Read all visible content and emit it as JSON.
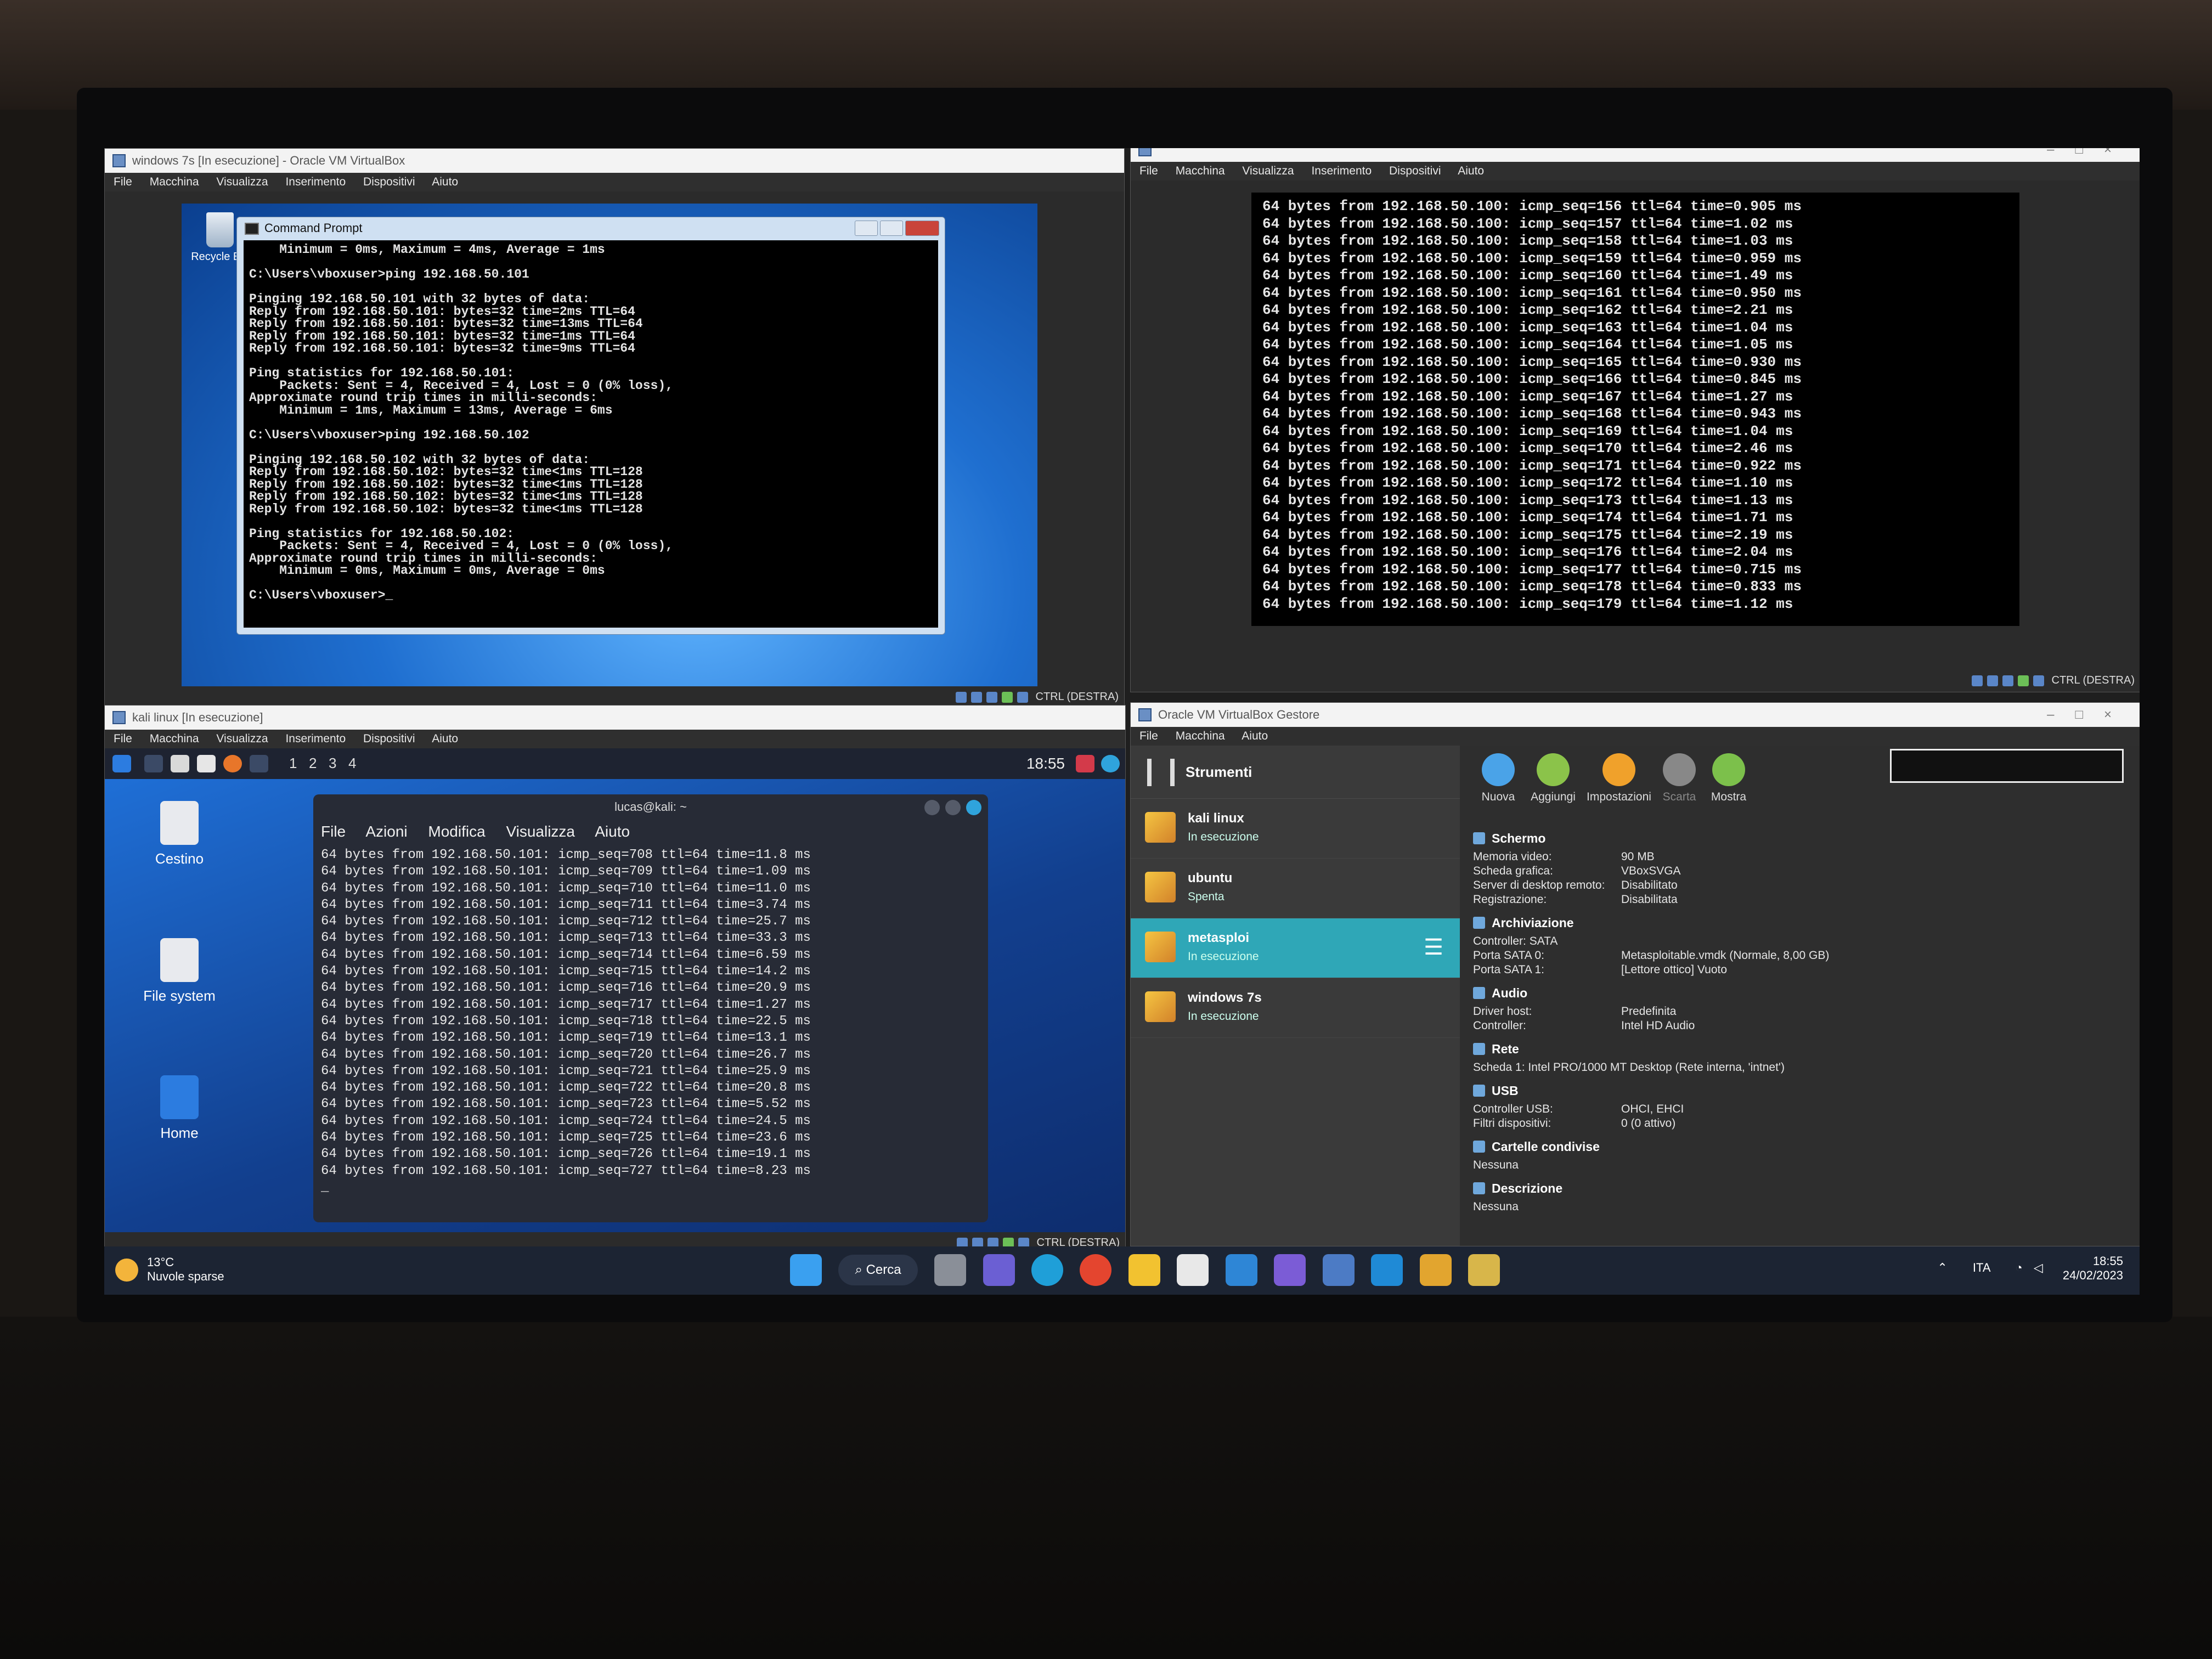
{
  "win7_vm": {
    "title": "windows 7s [In esecuzione] - Oracle VM VirtualBox",
    "menu": [
      "File",
      "Macchina",
      "Visualizza",
      "Inserimento",
      "Dispositivi",
      "Aiuto"
    ],
    "desktop_icon": "Recycle Bin",
    "cmd_title": "Command Prompt",
    "cmd_lines": [
      "    Minimum = 0ms, Maximum = 4ms, Average = 1ms",
      "",
      "C:\\Users\\vboxuser>ping 192.168.50.101",
      "",
      "Pinging 192.168.50.101 with 32 bytes of data:",
      "Reply from 192.168.50.101: bytes=32 time=2ms TTL=64",
      "Reply from 192.168.50.101: bytes=32 time=13ms TTL=64",
      "Reply from 192.168.50.101: bytes=32 time=1ms TTL=64",
      "Reply from 192.168.50.101: bytes=32 time=9ms TTL=64",
      "",
      "Ping statistics for 192.168.50.101:",
      "    Packets: Sent = 4, Received = 4, Lost = 0 (0% loss),",
      "Approximate round trip times in milli-seconds:",
      "    Minimum = 1ms, Maximum = 13ms, Average = 6ms",
      "",
      "C:\\Users\\vboxuser>ping 192.168.50.102",
      "",
      "Pinging 192.168.50.102 with 32 bytes of data:",
      "Reply from 192.168.50.102: bytes=32 time<1ms TTL=128",
      "Reply from 192.168.50.102: bytes=32 time<1ms TTL=128",
      "Reply from 192.168.50.102: bytes=32 time<1ms TTL=128",
      "Reply from 192.168.50.102: bytes=32 time<1ms TTL=128",
      "",
      "Ping statistics for 192.168.50.102:",
      "    Packets: Sent = 4, Received = 4, Lost = 0 (0% loss),",
      "Approximate round trip times in milli-seconds:",
      "    Minimum = 0ms, Maximum = 0ms, Average = 0ms",
      "",
      "C:\\Users\\vboxuser>_"
    ],
    "status_key": "CTRL (DESTRA)"
  },
  "meta_vm": {
    "menu": [
      "File",
      "Macchina",
      "Visualizza",
      "Inserimento",
      "Dispositivi",
      "Aiuto"
    ],
    "ping_lines": [
      "64 bytes from 192.168.50.100: icmp_seq=156 ttl=64 time=0.905 ms",
      "64 bytes from 192.168.50.100: icmp_seq=157 ttl=64 time=1.02 ms",
      "64 bytes from 192.168.50.100: icmp_seq=158 ttl=64 time=1.03 ms",
      "64 bytes from 192.168.50.100: icmp_seq=159 ttl=64 time=0.959 ms",
      "64 bytes from 192.168.50.100: icmp_seq=160 ttl=64 time=1.49 ms",
      "64 bytes from 192.168.50.100: icmp_seq=161 ttl=64 time=0.950 ms",
      "64 bytes from 192.168.50.100: icmp_seq=162 ttl=64 time=2.21 ms",
      "64 bytes from 192.168.50.100: icmp_seq=163 ttl=64 time=1.04 ms",
      "64 bytes from 192.168.50.100: icmp_seq=164 ttl=64 time=1.05 ms",
      "64 bytes from 192.168.50.100: icmp_seq=165 ttl=64 time=0.930 ms",
      "64 bytes from 192.168.50.100: icmp_seq=166 ttl=64 time=0.845 ms",
      "64 bytes from 192.168.50.100: icmp_seq=167 ttl=64 time=1.27 ms",
      "64 bytes from 192.168.50.100: icmp_seq=168 ttl=64 time=0.943 ms",
      "64 bytes from 192.168.50.100: icmp_seq=169 ttl=64 time=1.04 ms",
      "64 bytes from 192.168.50.100: icmp_seq=170 ttl=64 time=2.46 ms",
      "64 bytes from 192.168.50.100: icmp_seq=171 ttl=64 time=0.922 ms",
      "64 bytes from 192.168.50.100: icmp_seq=172 ttl=64 time=1.10 ms",
      "64 bytes from 192.168.50.100: icmp_seq=173 ttl=64 time=1.13 ms",
      "64 bytes from 192.168.50.100: icmp_seq=174 ttl=64 time=1.71 ms",
      "64 bytes from 192.168.50.100: icmp_seq=175 ttl=64 time=2.19 ms",
      "64 bytes from 192.168.50.100: icmp_seq=176 ttl=64 time=2.04 ms",
      "64 bytes from 192.168.50.100: icmp_seq=177 ttl=64 time=0.715 ms",
      "64 bytes from 192.168.50.100: icmp_seq=178 ttl=64 time=0.833 ms",
      "64 bytes from 192.168.50.100: icmp_seq=179 ttl=64 time=1.12 ms"
    ],
    "status_key": "CTRL (DESTRA)"
  },
  "kali_vm": {
    "title": "kali linux [In esecuzione]",
    "menu": [
      "File",
      "Macchina",
      "Visualizza",
      "Inserimento",
      "Dispositivi",
      "Aiuto"
    ],
    "workspaces": [
      "1",
      "2",
      "3",
      "4"
    ],
    "clock": "18:55",
    "desktop_icons": [
      "Cestino",
      "File system",
      "Home"
    ],
    "terminal_title": "lucas@kali: ~",
    "terminal_menu": [
      "File",
      "Azioni",
      "Modifica",
      "Visualizza",
      "Aiuto"
    ],
    "ping_lines": [
      "64 bytes from 192.168.50.101: icmp_seq=708 ttl=64 time=11.8 ms",
      "64 bytes from 192.168.50.101: icmp_seq=709 ttl=64 time=1.09 ms",
      "64 bytes from 192.168.50.101: icmp_seq=710 ttl=64 time=11.0 ms",
      "64 bytes from 192.168.50.101: icmp_seq=711 ttl=64 time=3.74 ms",
      "64 bytes from 192.168.50.101: icmp_seq=712 ttl=64 time=25.7 ms",
      "64 bytes from 192.168.50.101: icmp_seq=713 ttl=64 time=33.3 ms",
      "64 bytes from 192.168.50.101: icmp_seq=714 ttl=64 time=6.59 ms",
      "64 bytes from 192.168.50.101: icmp_seq=715 ttl=64 time=14.2 ms",
      "64 bytes from 192.168.50.101: icmp_seq=716 ttl=64 time=20.9 ms",
      "64 bytes from 192.168.50.101: icmp_seq=717 ttl=64 time=1.27 ms",
      "64 bytes from 192.168.50.101: icmp_seq=718 ttl=64 time=22.5 ms",
      "64 bytes from 192.168.50.101: icmp_seq=719 ttl=64 time=13.1 ms",
      "64 bytes from 192.168.50.101: icmp_seq=720 ttl=64 time=26.7 ms",
      "64 bytes from 192.168.50.101: icmp_seq=721 ttl=64 time=25.9 ms",
      "64 bytes from 192.168.50.101: icmp_seq=722 ttl=64 time=20.8 ms",
      "64 bytes from 192.168.50.101: icmp_seq=723 ttl=64 time=5.52 ms",
      "64 bytes from 192.168.50.101: icmp_seq=724 ttl=64 time=24.5 ms",
      "64 bytes from 192.168.50.101: icmp_seq=725 ttl=64 time=23.6 ms",
      "64 bytes from 192.168.50.101: icmp_seq=726 ttl=64 time=19.1 ms",
      "64 bytes from 192.168.50.101: icmp_seq=727 ttl=64 time=8.23 ms",
      "_"
    ],
    "status_key": "CTRL (DESTRA)"
  },
  "manager": {
    "title": "Oracle VM VirtualBox Gestore",
    "menu": [
      "File",
      "Macchina",
      "Aiuto"
    ],
    "tools_label": "Strumenti",
    "toolbar": [
      "Nuova",
      "Aggiungi",
      "Impostazioni",
      "Scarta",
      "Mostra"
    ],
    "vms": [
      {
        "name": "kali linux",
        "state": "In esecuzione"
      },
      {
        "name": "ubuntu",
        "state": "Spenta"
      },
      {
        "name": "metasploi",
        "state": "In esecuzione"
      },
      {
        "name": "windows 7s",
        "state": "In esecuzione"
      }
    ],
    "details": {
      "schermo_title": "Schermo",
      "schermo_rows": [
        [
          "Memoria video:",
          "90 MB"
        ],
        [
          "Scheda grafica:",
          "VBoxSVGA"
        ],
        [
          "Server di desktop remoto:",
          "Disabilitato"
        ],
        [
          "Registrazione:",
          "Disabilitata"
        ]
      ],
      "archiviazione_title": "Archiviazione",
      "archiviazione_rows": [
        [
          "Controller: SATA",
          ""
        ],
        [
          "  Porta SATA 0:",
          "Metasploitable.vmdk (Normale, 8,00 GB)"
        ],
        [
          "  Porta SATA 1:",
          "[Lettore ottico] Vuoto"
        ]
      ],
      "audio_title": "Audio",
      "audio_rows": [
        [
          "Driver host:",
          "Predefinita"
        ],
        [
          "Controller:",
          "Intel HD Audio"
        ]
      ],
      "rete_title": "Rete",
      "rete_rows": [
        [
          "Scheda 1:",
          "Intel PRO/1000 MT Desktop (Rete interna, 'intnet')"
        ]
      ],
      "usb_title": "USB",
      "usb_rows": [
        [
          "Controller USB:",
          "OHCI, EHCI"
        ],
        [
          "Filtri dispositivi:",
          "0 (0 attivo)"
        ]
      ],
      "cartelle_title": "Cartelle condivise",
      "cartelle_value": "Nessuna",
      "descrizione_title": "Descrizione",
      "descrizione_value": "Nessuna"
    }
  },
  "taskbar": {
    "temperature": "13°C",
    "weather": "Nuvole sparse",
    "search": "Cerca",
    "language": "ITA",
    "time": "18:55",
    "date": "24/02/2023"
  }
}
